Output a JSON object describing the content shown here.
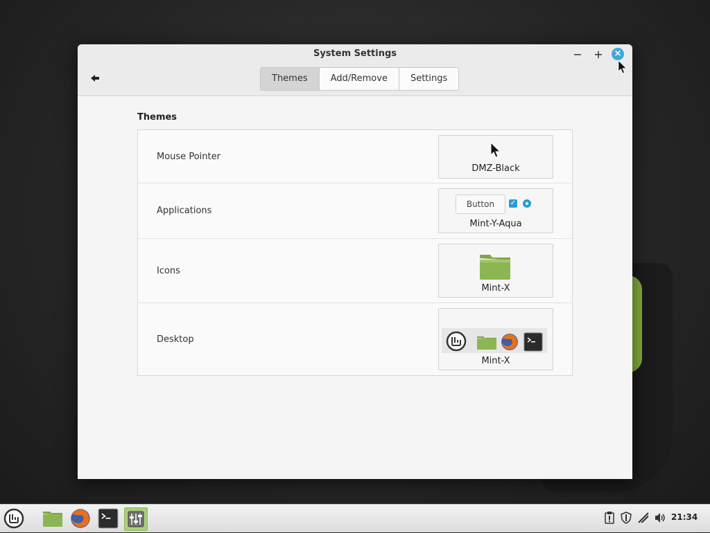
{
  "window": {
    "title": "System Settings",
    "minimize_label": "−",
    "maximize_label": "+",
    "close_label": "×"
  },
  "toolbar": {
    "back_icon": "arrow-left-icon",
    "tabs": [
      {
        "label": "Themes",
        "active": true
      },
      {
        "label": "Add/Remove",
        "active": false
      },
      {
        "label": "Settings",
        "active": false
      }
    ]
  },
  "themes": {
    "section_title": "Themes",
    "rows": [
      {
        "label": "Mouse Pointer",
        "value": "DMZ-Black",
        "preview_icon": "cursor-arrow-icon"
      },
      {
        "label": "Applications",
        "value": "Mint-Y-Aqua",
        "preview_button": "Button"
      },
      {
        "label": "Icons",
        "value": "Mint-X",
        "preview_icon": "folder-icon"
      },
      {
        "label": "Desktop",
        "value": "Mint-X",
        "preview_icons": [
          "mint-menu-icon",
          "folder-icon",
          "firefox-icon",
          "terminal-icon"
        ]
      }
    ]
  },
  "taskbar": {
    "launchers": [
      "mint-menu-icon",
      "folder-icon",
      "firefox-icon",
      "terminal-icon",
      "system-settings-icon"
    ],
    "tray": [
      "clipboard-alert-icon",
      "shield-icon",
      "network-icon",
      "volume-icon"
    ],
    "clock": "21:34"
  },
  "colors": {
    "accent": "#3fa9d6",
    "mint_green": "#86b040",
    "active_task": "#a9cf7a"
  }
}
